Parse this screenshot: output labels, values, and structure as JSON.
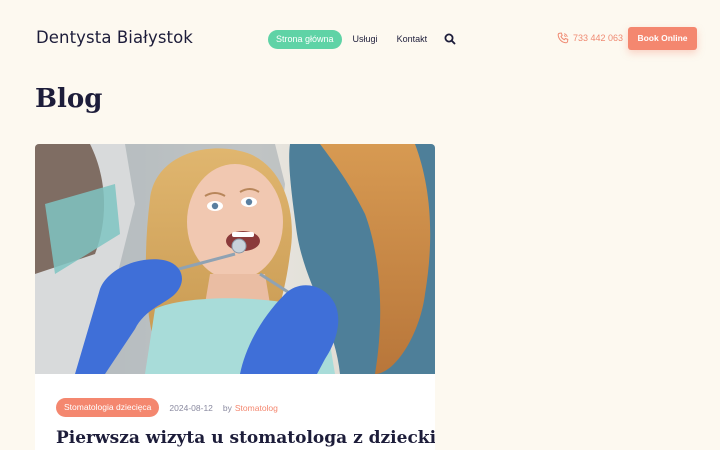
{
  "site": {
    "logo": "Dentysta Białystok"
  },
  "nav": {
    "items": [
      {
        "label": "Strona główna"
      },
      {
        "label": "Usługi"
      },
      {
        "label": "Kontakt"
      }
    ]
  },
  "header": {
    "phone": "733 442 063",
    "book_label": "Book Online"
  },
  "page": {
    "title": "Blog"
  },
  "post": {
    "category": "Stomatologia dziecięca",
    "date": "2024-08-12",
    "by": "by",
    "author": "Stomatolog",
    "title": "Pierwsza wizyta u stomatologa z dzieckiem –"
  },
  "colors": {
    "background": "#fdf9f0",
    "accent_green": "#5fd3a6",
    "accent_coral": "#f4876f",
    "text_dark": "#1d1d3a"
  }
}
